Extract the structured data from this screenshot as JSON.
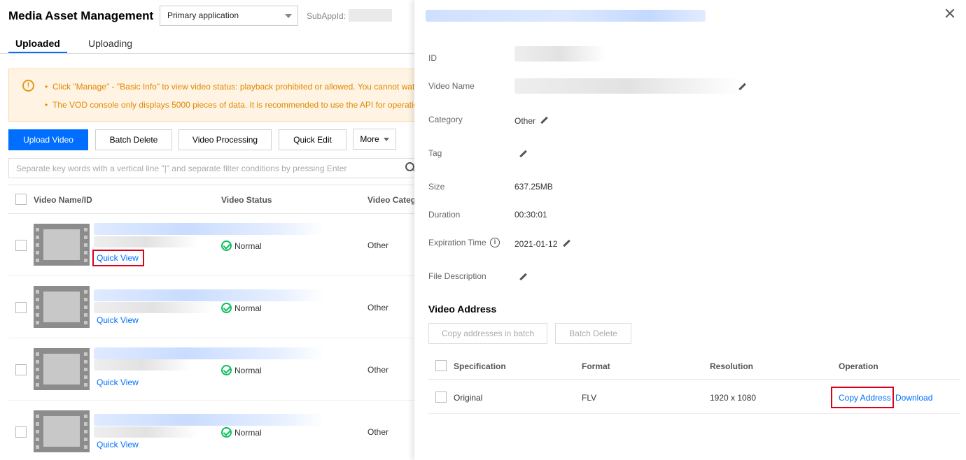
{
  "header": {
    "title": "Media Asset Management",
    "app_select_value": "Primary application",
    "subappid_label": "SubAppId:"
  },
  "tabs": [
    {
      "label": "Uploaded",
      "active": true
    },
    {
      "label": "Uploading",
      "active": false
    }
  ],
  "notice": {
    "icon": "!",
    "lines": [
      "Click \"Manage\" - \"Basic Info\" to view video status: playback prohibited or allowed. You cannot watch",
      "The VOD console only displays 5000 pieces of data. It is recommended to use the API for operatio"
    ]
  },
  "toolbar": {
    "upload_video": "Upload Video",
    "batch_delete": "Batch Delete",
    "video_processing": "Video Processing",
    "quick_edit": "Quick Edit",
    "more": "More"
  },
  "search": {
    "placeholder": "Separate key words with a vertical line \"|\" and separate filter conditions by pressing Enter"
  },
  "table": {
    "columns": [
      "Video Name/ID",
      "Video Status",
      "Video Categ"
    ],
    "rows": [
      {
        "quick_view": "Quick View",
        "status": "Normal",
        "category": "Other",
        "highlighted": true
      },
      {
        "quick_view": "Quick View",
        "status": "Normal",
        "category": "Other",
        "highlighted": false
      },
      {
        "quick_view": "Quick View",
        "status": "Normal",
        "category": "Other",
        "highlighted": false
      },
      {
        "quick_view": "Quick View",
        "status": "Normal",
        "category": "Other",
        "highlighted": false
      }
    ]
  },
  "drawer": {
    "fields": {
      "id_label": "ID",
      "video_name_label": "Video Name",
      "category_label": "Category",
      "category_value": "Other",
      "tag_label": "Tag",
      "size_label": "Size",
      "size_value": "637.25MB",
      "duration_label": "Duration",
      "duration_value": "00:30:01",
      "expiration_label": "Expiration Time",
      "expiration_value": "2021-01-12",
      "description_label": "File Description"
    },
    "video_address": {
      "title": "Video Address",
      "copy_batch": "Copy addresses in batch",
      "batch_delete": "Batch Delete",
      "columns": [
        "Specification",
        "Format",
        "Resolution",
        "Operation"
      ],
      "row": {
        "specification": "Original",
        "format": "FLV",
        "resolution": "1920 x 1080",
        "copy_address": "Copy Address",
        "download": "Download"
      }
    }
  },
  "colors": {
    "primary": "#006eff",
    "highlight_box": "#d9001b",
    "status_ok": "#0abf5b",
    "notice_text": "#e08700"
  }
}
